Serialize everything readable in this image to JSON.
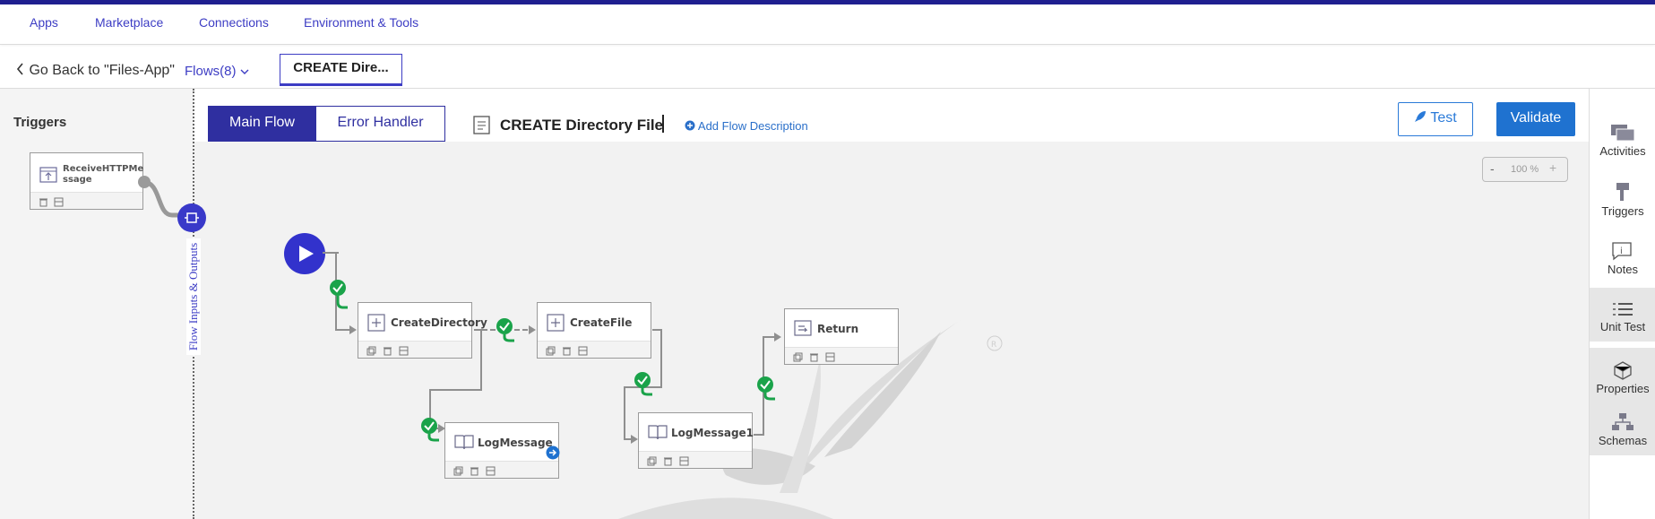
{
  "nav": {
    "apps": "Apps",
    "marketplace": "Marketplace",
    "connections": "Connections",
    "env_tools": "Environment & Tools"
  },
  "subbar": {
    "back": "Go Back to \"Files-App\"",
    "flows": "Flows(8)",
    "flow_tab": "CREATE Dire..."
  },
  "left": {
    "title": "Triggers",
    "trigger_node": "ReceiveHTTPMessage",
    "trigger_line1": "ReceiveHTTPMe",
    "trigger_line2": "ssage",
    "flow_io": "Flow Inputs & Outputs"
  },
  "header": {
    "main_flow": "Main Flow",
    "error_handler": "Error Handler",
    "flow_name": "CREATE Directory File",
    "add_desc": "Add Flow Description",
    "test": "Test",
    "validate": "Validate"
  },
  "zoom": {
    "minus": "-",
    "level": "100 %",
    "plus": "+"
  },
  "nodes": {
    "create_directory": "CreateDirectory",
    "create_file": "CreateFile",
    "log_message": "LogMessage",
    "log_message1": "LogMessage1",
    "return": "Return"
  },
  "rightbar": {
    "activities": "Activities",
    "triggers": "Triggers",
    "notes": "Notes",
    "unit_test": "Unit Test",
    "properties": "Properties",
    "schemas": "Schemas"
  },
  "colors": {
    "accent": "#3d3dc4",
    "brand_bar": "#1f1f8f",
    "success": "#1aa34a",
    "primary_button": "#1f72d0"
  }
}
